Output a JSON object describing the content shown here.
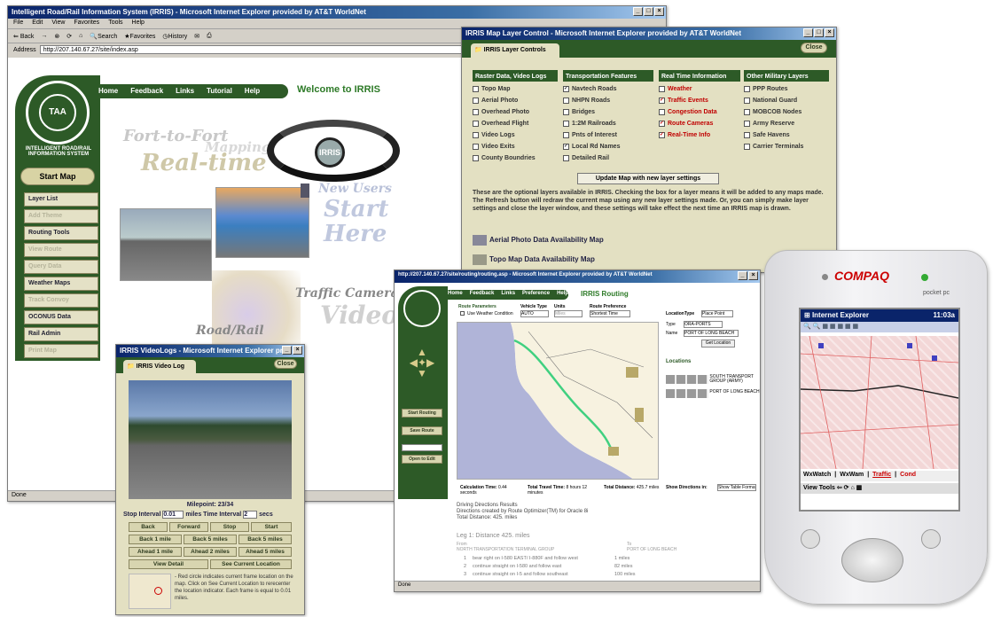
{
  "main_window": {
    "title": "Intelligent Road/Rail Information System (IRRIS) - Microsoft Internet Explorer provided by AT&T WorldNet",
    "menu": [
      "File",
      "Edit",
      "View",
      "Favorites",
      "Tools",
      "Help"
    ],
    "toolbar": [
      "Back",
      "Search",
      "Favorites",
      "History"
    ],
    "address_label": "Address",
    "address": "http://207.140.67.27/site/index.asp",
    "nav": [
      "Home",
      "Feedback",
      "Links",
      "Tutorial",
      "Help"
    ],
    "welcome": "Welcome to IRRIS",
    "logo_text": "INTELLIGENT ROAD/RAIL INFORMATION SYSTEM",
    "start_map": "Start Map",
    "side_buttons": [
      "Layer List",
      "Add Theme",
      "Routing Tools",
      "View Route",
      "Query Data",
      "Weather Maps",
      "Track Convoy",
      "OCONUS Data",
      "Rail Admin",
      "Print Map"
    ],
    "splash": {
      "fort": "Fort-to-Fort",
      "mapping": "Mapping",
      "realtime": "Real-time",
      "new_users": "New Users",
      "start": "Start",
      "here": "Here",
      "traffic": "Traffic Camera",
      "video": "Video",
      "roadrail": "Road/Rail"
    },
    "status": "Done"
  },
  "layer_window": {
    "title": "IRRIS Map Layer Control - Microsoft Internet Explorer provided by AT&T WorldNet",
    "close_btn": "Close",
    "tab": "IRRIS Layer Controls",
    "columns": [
      {
        "header": "Raster Data, Video Logs",
        "items": [
          {
            "label": "Topo Map",
            "checked": false
          },
          {
            "label": "Aerial Photo",
            "checked": false
          },
          {
            "label": "Overhead Photo",
            "checked": false
          },
          {
            "label": "Overhead Flight",
            "checked": false
          },
          {
            "label": "Video Logs",
            "checked": false
          },
          {
            "label": "Video Exits",
            "checked": false
          },
          {
            "label": "County Boundries",
            "checked": false
          }
        ]
      },
      {
        "header": "Transportation Features",
        "items": [
          {
            "label": "Navtech Roads",
            "checked": true
          },
          {
            "label": "NHPN Roads",
            "checked": false
          },
          {
            "label": "Bridges",
            "checked": false
          },
          {
            "label": "1:2M Railroads",
            "checked": false
          },
          {
            "label": "Pnts of Interest",
            "checked": false
          },
          {
            "label": "Local Rd Names",
            "checked": true
          },
          {
            "label": "Detailed Rail",
            "checked": false
          }
        ]
      },
      {
        "header": "Real Time Information",
        "items": [
          {
            "label": "Weather",
            "checked": false,
            "red": true
          },
          {
            "label": "Traffic Events",
            "checked": true,
            "red": true
          },
          {
            "label": "Congestion Data",
            "checked": false,
            "red": true
          },
          {
            "label": "Route Cameras",
            "checked": true,
            "red": true
          },
          {
            "label": "Real-Time Info",
            "checked": true,
            "red": true
          }
        ]
      },
      {
        "header": "Other Military Layers",
        "items": [
          {
            "label": "PPP Routes",
            "checked": false
          },
          {
            "label": "National Guard",
            "checked": false
          },
          {
            "label": "MOBCOB Nodes",
            "checked": false
          },
          {
            "label": "Army Reserve",
            "checked": false
          },
          {
            "label": "Safe Havens",
            "checked": false
          },
          {
            "label": "Carrier Terminals",
            "checked": false
          }
        ]
      }
    ],
    "update_btn": "Update Map with new layer settings",
    "help_text": "These are the optional layers available in IRRIS. Checking the box for a layer means it will be added to any maps made. The Refresh button will redraw the current map using any new layer settings made. Or, you can simply make layer settings and close the layer window, and these settings will take effect the next time an IRRIS map is drawn.",
    "links": [
      "Aerial Photo Data Availability Map",
      "Topo Map Data Availability Map"
    ]
  },
  "video_window": {
    "title": "IRRIS VideoLogs - Microsoft Internet Explorer pro",
    "close_btn": "Close",
    "tab": "IRRIS Video Log",
    "milepoint": "Milepoint: 23/34",
    "stop_interval_label": "Stop Interval",
    "stop_interval": "0.01",
    "miles": "miles",
    "time_interval_label": "Time Interval",
    "time_interval": "2",
    "secs": "secs",
    "buttons": [
      [
        "Back",
        "Forward",
        "Stop",
        "Start"
      ],
      [
        "Back 1 mile",
        "Back 5 miles",
        "Back 5 miles"
      ],
      [
        "Ahead 1 mile",
        "Ahead 2 miles",
        "Ahead 5 miles"
      ],
      [
        "View Detail",
        "See Current Location"
      ]
    ],
    "note": "- Red circle indicates current frame location on the map. Click on See Current Location to rerecenter the location indicator. Each frame is equal to 0.01 miles."
  },
  "routing_window": {
    "title": "http://207.140.67.27/site/routing/routing.asp - Microsoft Internet Explorer provided by AT&T WorldNet",
    "nav": [
      "Home",
      "Feedback",
      "Links",
      "Preference",
      "Help"
    ],
    "heading": "IRRIS Routing",
    "route_params": "Route Parameters",
    "weather_cond": "Use Weather Condition",
    "vehicle_type_label": "Vehicle Type",
    "vehicle_type": "AUTO",
    "units_label": "Units",
    "units": "Miles",
    "route_pref_label": "Route Preference",
    "route_pref": "Shortest Time",
    "side_buttons": [
      "Start Routing",
      "Save Route",
      "",
      "Open to Edit"
    ],
    "loc_type_label": "LocationType",
    "loc_type": "Place Point",
    "type_label": "Type",
    "type_val": "ORA-PORTS",
    "name_label": "Name",
    "name_val": "PORT OF LONG BEACH",
    "get_location": "Get Location",
    "locations_label": "Locations",
    "loc1": "SOUTH TRANSPORT GROUP (ARMY)",
    "loc2": "PORT OF LONG BEACH",
    "calc_time_label": "Calculation Time:",
    "calc_time": "0.44 seconds",
    "travel_time_label": "Total Travel Time:",
    "travel_time": "8 hours 12 minutes",
    "distance_label": "Total Distance:",
    "distance": "425.7 miles",
    "show_dir_label": "Show Directions in:",
    "show_dir": "Show Table Format",
    "driving_dir": "Driving Directions Results",
    "created_by": "Directions created by Route Optimizer(TM) for Oracle 8i",
    "total_dist": "Total Distance: 425. miles",
    "leg": "Leg 1: Distance 425. miles",
    "from_label": "From",
    "from_val": "NORTH TRANSPORTATION TERMINAL GROUP",
    "to_label": "To",
    "to_val": "PORT OF LONG BEACH",
    "steps": [
      [
        "1",
        "bear right on I-580 EAST/ I-880F and follow west",
        "1 miles"
      ],
      [
        "2",
        "continue straight on I-580 and follow east",
        "82 miles"
      ],
      [
        "3",
        "continue straight on I-5 and follow southeast",
        "100 miles"
      ]
    ],
    "status": "Done"
  },
  "pda": {
    "brand": "COMPAQ",
    "pocketpc": "pocket pc",
    "app": "Internet Explorer",
    "time": "11:03a",
    "tabs": [
      "WxWatch",
      "WxWam",
      "Traffic",
      "Cond"
    ],
    "menu": "View Tools"
  }
}
